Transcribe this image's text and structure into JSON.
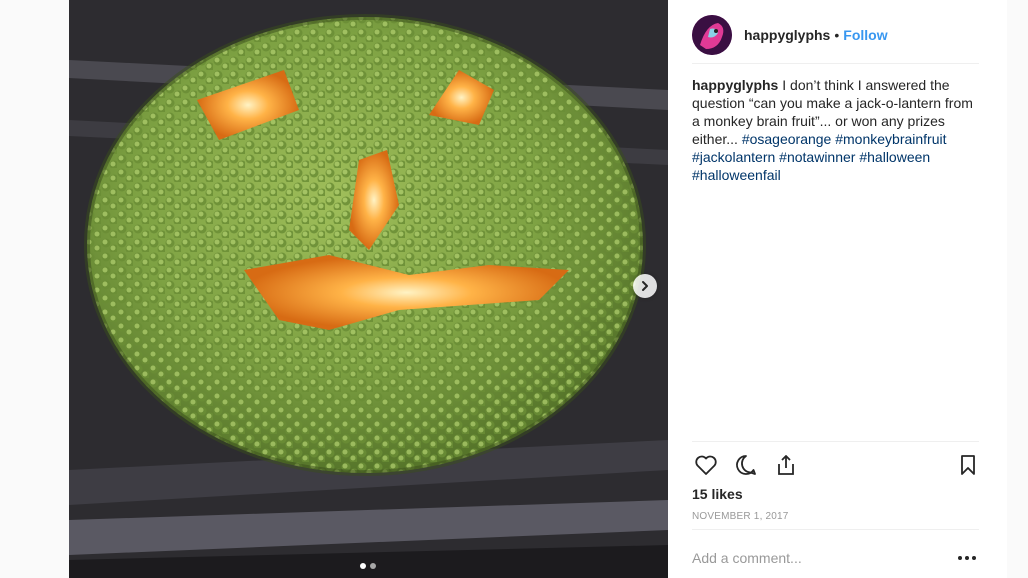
{
  "post": {
    "username": "happyglyphs",
    "separator": "•",
    "follow_label": "Follow",
    "caption_text": " I don’t think I answered the question “can you make a jack-o-lantern from a monkey brain fruit”... or won any prizes either... ",
    "hashtags": [
      "#osageorange",
      "#monkeybrainfruit",
      "#jackolantern",
      "#notawinner",
      "#halloween",
      "#halloweenfail"
    ],
    "likes": "15 likes",
    "date": "NOVEMBER 1, 2017",
    "comment_placeholder": "Add a comment..."
  },
  "media": {
    "carousel_count": 2,
    "carousel_active_index": 0
  },
  "icons": {
    "like": "heart-icon",
    "comment": "comment-bubble-icon",
    "share": "share-icon",
    "save": "bookmark-icon",
    "next": "chevron-right-icon",
    "more": "more-options-icon"
  },
  "colors": {
    "link_blue": "#3897f0",
    "hashtag_navy": "#003569",
    "muted_gray": "#999999"
  }
}
